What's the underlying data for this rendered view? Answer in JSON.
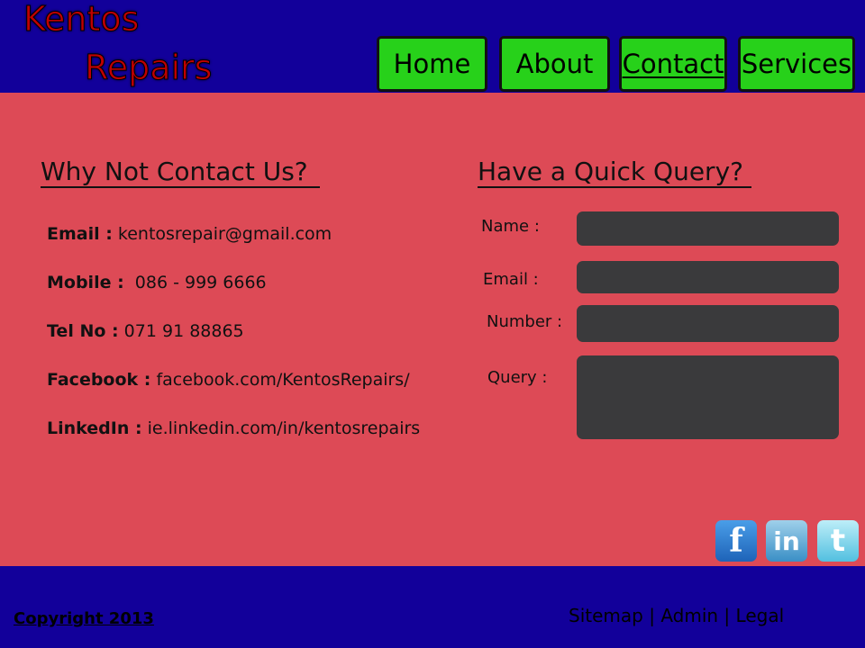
{
  "logo": {
    "line1": "Kentos",
    "line2": "Repairs"
  },
  "nav": {
    "items": [
      "Home",
      "About",
      "Contact",
      "Services"
    ],
    "active": "Contact"
  },
  "contact": {
    "heading": "Why Not Contact Us?",
    "email_label": "Email :",
    "email_value": "kentosrepair@gmail.com",
    "mobile_label": "Mobile :",
    "mobile_value": "086 - 999 6666",
    "tel_label": "Tel No :",
    "tel_value": "071 91 88865",
    "facebook_label": "Facebook :",
    "facebook_value": "facebook.com/KentosRepairs/",
    "linkedin_label": "LinkedIn :",
    "linkedin_value": "ie.linkedin.com/in/kentosrepairs"
  },
  "query": {
    "heading": "Have a Quick Query?",
    "name_label": "Name :",
    "email_label": "Email :",
    "number_label": "Number :",
    "query_label": "Query :"
  },
  "social": {
    "icons": [
      "facebook-icon",
      "linkedin-icon",
      "twitter-icon"
    ]
  },
  "footer": {
    "copyright": "Copyright 2013",
    "sitemap": "Sitemap",
    "admin": "Admin",
    "legal": "Legal",
    "separator": "|"
  },
  "colors": {
    "header_bg": "#12009a",
    "main_bg": "#dd4a56",
    "nav_btn": "#27d11a",
    "field_bg": "#3a3a3c"
  }
}
